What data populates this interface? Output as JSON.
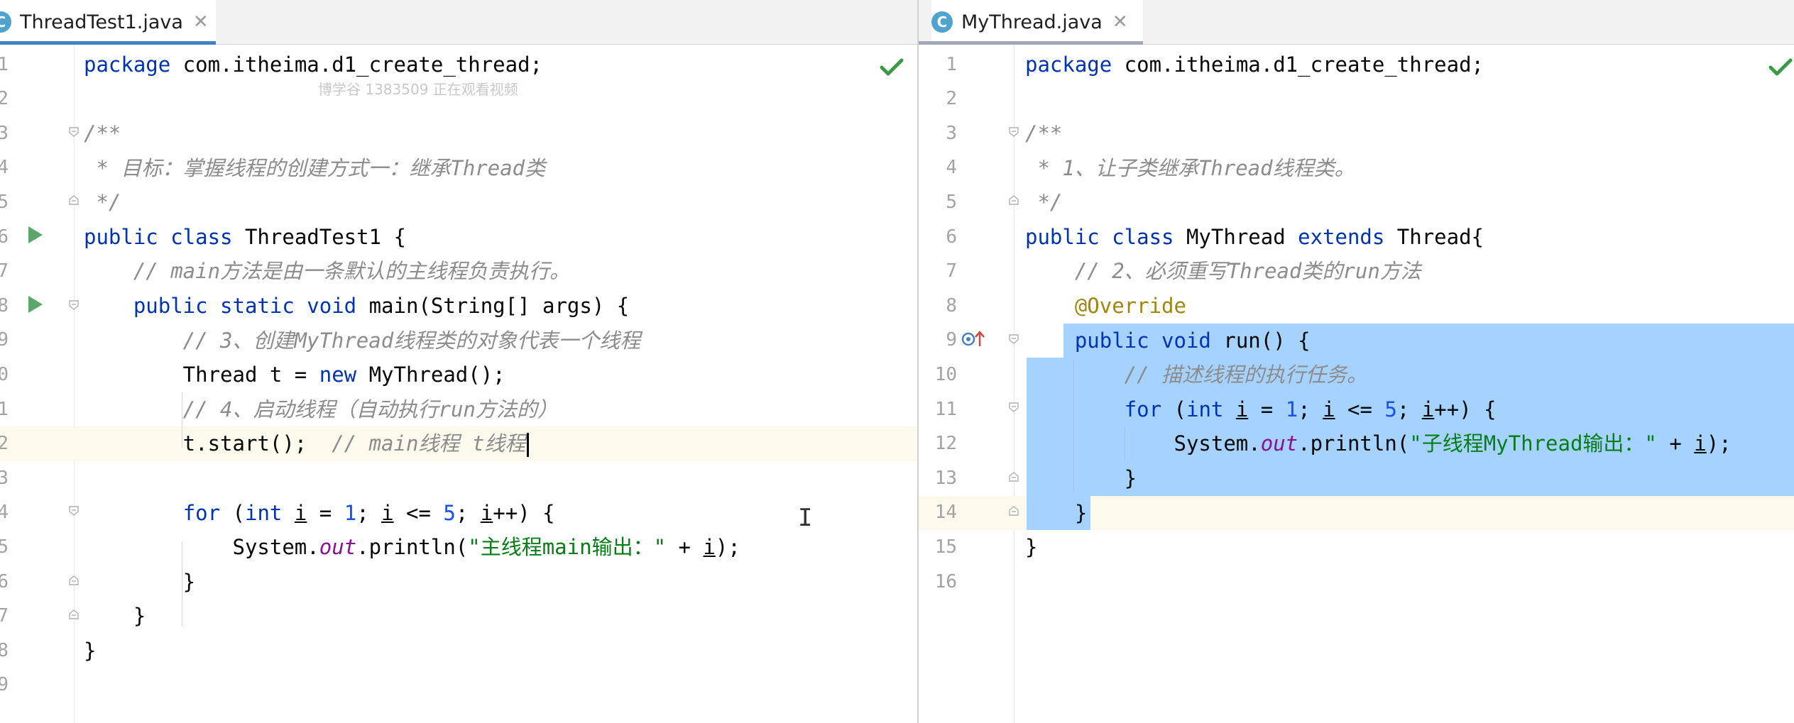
{
  "colors": {
    "keyword": "#0033b3",
    "comment": "#8c8c8c",
    "number": "#1750eb",
    "string": "#067d17",
    "annotation": "#9e880d",
    "static_field": "#871094",
    "selection": "#a6d2ff",
    "current_line": "#fcfaed",
    "tab_accent": "#4083c9",
    "tab_inactive_accent": "#a0a8b8",
    "success_check": "#3c9a46",
    "run_icon": "#59a869"
  },
  "left_editor": {
    "tab": {
      "icon": "C",
      "title": "ThreadTest1.java",
      "close": "✕",
      "icon_name": "java-class-icon"
    },
    "watermark": "博学谷 1383509 正在观看视频",
    "status_icon": "check-icon",
    "line_numbers": [
      "1",
      "2",
      "3",
      "4",
      "5",
      "6",
      "7",
      "8",
      "9",
      "0",
      "1",
      "2",
      "3",
      "4",
      "5",
      "6",
      "7",
      "8",
      "9"
    ],
    "code": {
      "l1_kw": "package",
      "l1_rest": " com.itheima.d1_create_thread;",
      "l3": "/**",
      "l4": " * 目标：掌握线程的创建方式一：继承Thread类",
      "l5": " */",
      "l6_kw": "public class",
      "l6_rest": " ThreadTest1 {",
      "l7": "    // main方法是由一条默认的主线程负责执行。",
      "l8_kw": "    public static void",
      "l8_rest": " main(String[] args) {",
      "l9": "        // 3、创建MyThread线程类的对象代表一个线程",
      "l10_a": "        Thread t = ",
      "l10_kw": "new",
      "l10_b": " MyThread();",
      "l11": "        // 4、启动线程（自动执行run方法的）",
      "l12_a": "        t.start();  ",
      "l12_cm": "// main线程 t线程",
      "l14_a": "        ",
      "l14_kw1": "for",
      "l14_b": " (",
      "l14_kw2": "int",
      "l14_c": " ",
      "l14_v1": "i",
      "l14_d": " = ",
      "l14_n1": "1",
      "l14_e": "; ",
      "l14_v2": "i",
      "l14_f": " <= ",
      "l14_n2": "5",
      "l14_g": "; ",
      "l14_v3": "i",
      "l14_h": "++) {",
      "l15_a": "            System.",
      "l15_fld": "out",
      "l15_b": ".println(",
      "l15_str": "\"主线程main输出：\"",
      "l15_c": " + ",
      "l15_v": "i",
      "l15_d": ");",
      "l16": "        }",
      "l17": "    }",
      "l18": "}"
    }
  },
  "right_editor": {
    "tab": {
      "icon": "C",
      "title": "MyThread.java",
      "close": "✕",
      "icon_name": "java-class-icon"
    },
    "status_icon": "check-icon",
    "override_marker": "overrides-method-icon",
    "line_numbers": [
      "1",
      "2",
      "3",
      "4",
      "5",
      "6",
      "7",
      "8",
      "9",
      "10",
      "11",
      "12",
      "13",
      "14",
      "15",
      "16"
    ],
    "code": {
      "l1_kw": "package",
      "l1_rest": " com.itheima.d1_create_thread;",
      "l3": "/**",
      "l4": " * 1、让子类继承Thread线程类。",
      "l5": " */",
      "l6_kw1": "public class",
      "l6_mid": " MyThread ",
      "l6_kw2": "extends",
      "l6_rest": " Thread{",
      "l7": "    // 2、必须重写Thread类的run方法",
      "l8_ann": "    @Override",
      "l9_kw": "    public void",
      "l9_rest": " run() {",
      "l10": "        // 描述线程的执行任务。",
      "l11_a": "        ",
      "l11_kw1": "for",
      "l11_b": " (",
      "l11_kw2": "int",
      "l11_c": " ",
      "l11_v1": "i",
      "l11_d": " = ",
      "l11_n1": "1",
      "l11_e": "; ",
      "l11_v2": "i",
      "l11_f": " <= ",
      "l11_n2": "5",
      "l11_g": "; ",
      "l11_v3": "i",
      "l11_h": "++) {",
      "l12_a": "            System.",
      "l12_fld": "out",
      "l12_b": ".println(",
      "l12_str": "\"子线程MyThread输出：\"",
      "l12_c": " + ",
      "l12_v": "i",
      "l12_d": ");",
      "l13": "        }",
      "l14": "    }",
      "l15": "}"
    }
  }
}
